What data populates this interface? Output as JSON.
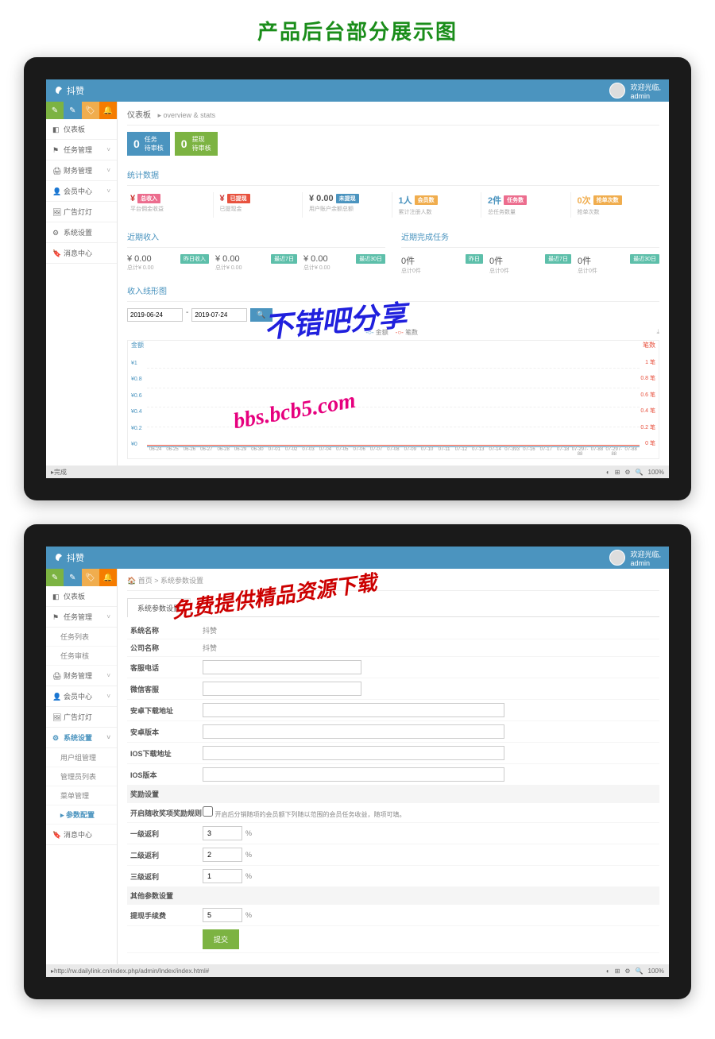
{
  "page_title": "产品后台部分展示图",
  "app_name": "抖赞",
  "user": {
    "welcome": "欢迎光临,",
    "name": "admin"
  },
  "screen1": {
    "sidebar": {
      "items": [
        "仪表板",
        "任务管理",
        "财务管理",
        "会员中心",
        "广告灯灯",
        "系统设置",
        "消息中心"
      ]
    },
    "crumb": {
      "title": "仪表板",
      "sub": "overview & stats"
    },
    "stat_boxes": [
      {
        "num": "0",
        "label1": "任务",
        "label2": "待审核"
      },
      {
        "num": "0",
        "label1": "提现",
        "label2": "待审核"
      }
    ],
    "section_stats": "统计数据",
    "metrics": [
      {
        "val": "¥",
        "lbl": "平台佣金收益",
        "badge": "总收入",
        "badge_color": "pink",
        "val_color": "yen"
      },
      {
        "val": "¥",
        "lbl": "已提现金",
        "badge": "已提现",
        "badge_color": "red",
        "val_color": "yen"
      },
      {
        "val": "¥ 0.00",
        "lbl": "用户账户余额总额",
        "badge": "未提现",
        "badge_color": "blue",
        "val_color": ""
      },
      {
        "val": "1人",
        "lbl": "累计注册人数",
        "badge": "会员数",
        "badge_color": "orange",
        "val_color": "blue"
      },
      {
        "val": "2件",
        "lbl": "总任务数量",
        "badge": "任务数",
        "badge_color": "pink",
        "val_color": "blue"
      },
      {
        "val": "0次",
        "lbl": "抢单次数",
        "badge": "抢单次数",
        "badge_color": "orange",
        "val_color": "orange"
      }
    ],
    "section_income": "近期收入",
    "income_items": [
      {
        "v": "¥ 0.00",
        "s": "总计¥ 0.00",
        "badge": "昨日收入"
      },
      {
        "v": "¥ 0.00",
        "s": "总计¥ 0.00",
        "badge": "最近7日"
      },
      {
        "v": "¥ 0.00",
        "s": "总计¥ 0.00",
        "badge": "最近30日"
      }
    ],
    "section_tasks": "近期完成任务",
    "task_items": [
      {
        "v": "0件",
        "s": "总计0件",
        "badge": "昨日"
      },
      {
        "v": "0件",
        "s": "总计0件",
        "badge": "最近7日"
      },
      {
        "v": "0件",
        "s": "总计0件",
        "badge": "最近30日"
      }
    ],
    "section_chart": "收入线形图",
    "date_from": "2019-06-24",
    "date_to": "2019-07-24",
    "legend": [
      "金额",
      "笔数"
    ],
    "download_label": "下载"
  },
  "chart_data": {
    "type": "line",
    "title": "收入线形图",
    "x": [
      "06-24",
      "06-25",
      "06-26",
      "06-27",
      "06-28",
      "06-29",
      "06-30",
      "07-01",
      "07-02",
      "07-03",
      "07-04",
      "07-05",
      "07-06",
      "07-07",
      "07-08",
      "07-09",
      "07-10",
      "07-11",
      "07-12",
      "07-13",
      "07-14",
      "07-393",
      "07-16",
      "07-17",
      "07-18",
      "07-297-88",
      "07-88",
      "07-297-88",
      "07-88"
    ],
    "series": [
      {
        "name": "金额",
        "axis": "left",
        "values": [
          0,
          0,
          0,
          0,
          0,
          0,
          0,
          0,
          0,
          0,
          0,
          0,
          0,
          0,
          0,
          0,
          0,
          0,
          0,
          0,
          0,
          0,
          0,
          0,
          0,
          0,
          0,
          0,
          0,
          0
        ]
      },
      {
        "name": "笔数",
        "axis": "right",
        "values": [
          0,
          0,
          0,
          0,
          0,
          0,
          0,
          0,
          0,
          0,
          0,
          0,
          0,
          0,
          0,
          0,
          0,
          0,
          0,
          0,
          0,
          0,
          0,
          0,
          0,
          0,
          0,
          0,
          0,
          0
        ]
      }
    ],
    "y_left_label": "金额",
    "y_left_ticks": [
      "¥1",
      "¥0.8",
      "¥0.6",
      "¥0.4",
      "¥0.2",
      "¥0"
    ],
    "y_right_label": "笔数",
    "y_right_ticks": [
      "1 笔",
      "0.8 笔",
      "0.6 笔",
      "0.4 笔",
      "0.2 笔",
      "0 笔"
    ]
  },
  "screen2": {
    "crumb": "首页 > 系统参数设置",
    "sidebar": {
      "items": [
        "仪表板",
        "任务管理",
        "财务管理",
        "会员中心",
        "广告灯灯",
        "系统设置",
        "消息中心"
      ],
      "task_sub": [
        "任务列表",
        "任务审核"
      ],
      "sys_sub": [
        "用户组管理",
        "管理员列表",
        "菜单管理",
        "参数配置"
      ]
    },
    "tab": "系统参数设置",
    "fields": {
      "sys_name": {
        "label": "系统名称",
        "value": "抖赞"
      },
      "company": {
        "label": "公司名称",
        "value": "抖赞"
      },
      "phone": {
        "label": "客服电话",
        "value": ""
      },
      "wechat": {
        "label": "微信客服",
        "value": ""
      },
      "android_url": {
        "label": "安卓下载地址",
        "value": ""
      },
      "android_ver": {
        "label": "安卓版本",
        "value": ""
      },
      "ios_url": {
        "label": "IOS下载地址",
        "value": ""
      },
      "ios_ver": {
        "label": "IOS版本",
        "value": ""
      }
    },
    "section_bonus": "奖励设置",
    "bonus": {
      "rule_label": "开启随收奖项奖励规则",
      "rule_note": "开启后分销随项的会员额下列随以范围的会员任务收益，随项可填。",
      "l1": {
        "label": "一级返利",
        "value": "3",
        "unit": "%"
      },
      "l2": {
        "label": "二级返利",
        "value": "2",
        "unit": "%"
      },
      "l3": {
        "label": "三级返利",
        "value": "1",
        "unit": "%"
      }
    },
    "section_other": "其他参数设置",
    "withdraw": {
      "label": "提现手续费",
      "value": "5",
      "unit": "%"
    },
    "submit": "提交",
    "status_url": "http://rw.dailylink.cn/index.php/admin/Index/index.html#"
  },
  "watermarks": {
    "w1": "不错吧分享",
    "w2": "bbs.bcb5.com",
    "w3": "免费提供精品资源下载"
  },
  "status": {
    "left": "完成",
    "zoom": "100%"
  }
}
